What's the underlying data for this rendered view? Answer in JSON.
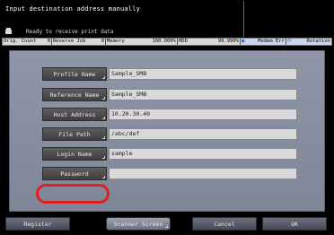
{
  "header": {
    "title": "Input destination address manually",
    "status": "Ready to receive print data"
  },
  "infobar": {
    "orig_count_label": "Orig. Count",
    "orig_count_value": "0",
    "reserve_job_label": "Reserve Job",
    "reserve_job_value": "0",
    "memory_label": "Memory",
    "memory_value": "100.000%",
    "hdd_label": "HDD",
    "hdd_value": "99.990%",
    "modem_label": "Modem Err",
    "rotation_label": "Rotation"
  },
  "form": {
    "rows": [
      {
        "label": "Profile Name",
        "value": "Sample_SMB"
      },
      {
        "label": "Reference Name",
        "value": "Sample_SMB"
      },
      {
        "label": "Host Address",
        "value": "10.20.30.40"
      },
      {
        "label": "File Path",
        "value": "/abc/def"
      },
      {
        "label": "Login Name",
        "value": "sample"
      },
      {
        "label": "Password",
        "value": ""
      }
    ]
  },
  "footer": {
    "register": "Register",
    "scanner_screen": "Scanner Screen",
    "cancel": "Cancel",
    "ok": "OK"
  },
  "colors": {
    "panel": "#868e9f",
    "highlight": "#e02020",
    "active_tab": "#3fa63f"
  }
}
